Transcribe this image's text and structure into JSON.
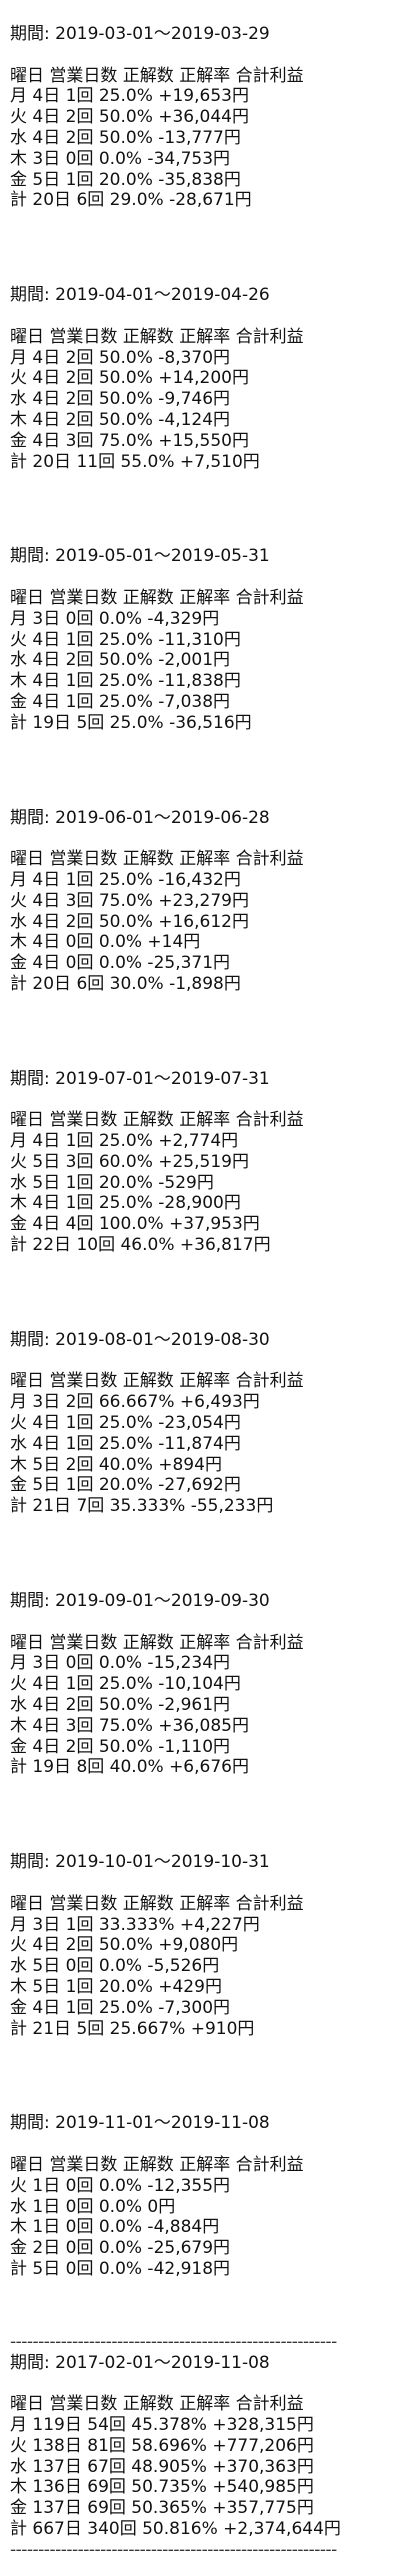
{
  "sections": [
    {
      "period": "期間: 2019-03-01～2019-03-29",
      "header": "曜日 営業日数 正解数 正解率 合計利益",
      "rows": [
        "月 4日 1回 25.0% +19,653円",
        "火 4日 2回 50.0% +36,044円",
        "水 4日 2回 50.0% -13,777円",
        "木 3日 0回 0.0% -34,753円",
        "金 5日 1回 20.0% -35,838円",
        "計 20日 6回 29.0% -28,671円"
      ]
    },
    {
      "period": "期間: 2019-04-01～2019-04-26",
      "header": "曜日 営業日数 正解数 正解率 合計利益",
      "rows": [
        "月 4日 2回 50.0% -8,370円",
        "火 4日 2回 50.0% +14,200円",
        "水 4日 2回 50.0% -9,746円",
        "木 4日 2回 50.0% -4,124円",
        "金 4日 3回 75.0% +15,550円",
        "計 20日 11回 55.0% +7,510円"
      ]
    },
    {
      "period": "期間: 2019-05-01～2019-05-31",
      "header": "曜日 営業日数 正解数 正解率 合計利益",
      "rows": [
        "月 3日 0回 0.0% -4,329円",
        "火 4日 1回 25.0% -11,310円",
        "水 4日 2回 50.0% -2,001円",
        "木 4日 1回 25.0% -11,838円",
        "金 4日 1回 25.0% -7,038円",
        "計 19日 5回 25.0% -36,516円"
      ]
    },
    {
      "period": "期間: 2019-06-01～2019-06-28",
      "header": "曜日 営業日数 正解数 正解率 合計利益",
      "rows": [
        "月 4日 1回 25.0% -16,432円",
        "火 4日 3回 75.0% +23,279円",
        "水 4日 2回 50.0% +16,612円",
        "木 4日 0回 0.0% +14円",
        "金 4日 0回 0.0% -25,371円",
        "計 20日 6回 30.0% -1,898円"
      ]
    },
    {
      "period": "期間: 2019-07-01～2019-07-31",
      "header": "曜日 営業日数 正解数 正解率 合計利益",
      "rows": [
        "月 4日 1回 25.0% +2,774円",
        "火 5日 3回 60.0% +25,519円",
        "水 5日 1回 20.0% -529円",
        "木 4日 1回 25.0% -28,900円",
        "金 4日 4回 100.0% +37,953円",
        "計 22日 10回 46.0% +36,817円"
      ]
    },
    {
      "period": "期間: 2019-08-01～2019-08-30",
      "header": "曜日 営業日数 正解数 正解率 合計利益",
      "rows": [
        "月 3日 2回 66.667% +6,493円",
        "火 4日 1回 25.0% -23,054円",
        "水 4日 1回 25.0% -11,874円",
        "木 5日 2回 40.0% +894円",
        "金 5日 1回 20.0% -27,692円",
        "計 21日 7回 35.333% -55,233円"
      ]
    },
    {
      "period": "期間: 2019-09-01～2019-09-30",
      "header": "曜日 営業日数 正解数 正解率 合計利益",
      "rows": [
        "月 3日 0回 0.0% -15,234円",
        "火 4日 1回 25.0% -10,104円",
        "水 4日 2回 50.0% -2,961円",
        "木 4日 3回 75.0% +36,085円",
        "金 4日 2回 50.0% -1,110円",
        "計 19日 8回 40.0% +6,676円"
      ]
    },
    {
      "period": "期間: 2019-10-01～2019-10-31",
      "header": "曜日 営業日数 正解数 正解率 合計利益",
      "rows": [
        "月 3日 1回 33.333% +4,227円",
        "火 4日 2回 50.0% +9,080円",
        "水 5日 0回 0.0% -5,526円",
        "木 5日 1回 20.0% +429円",
        "金 4日 1回 25.0% -7,300円",
        "計 21日 5回 25.667% +910円"
      ]
    },
    {
      "period": "期間: 2019-11-01～2019-11-08",
      "header": "曜日 営業日数 正解数 正解率 合計利益",
      "rows": [
        "火 1日 0回 0.0% -12,355円",
        "水 1日 0回 0.0% 0円",
        "木 1日 0回 0.0% -4,884円",
        "金 2日 0回 0.0% -25,679円",
        "計 5日 0回 0.0% -42,918円"
      ]
    }
  ],
  "summary": {
    "separator_top": "----------------------------------------------------------",
    "period": "期間: 2017-02-01～2019-11-08",
    "header": "曜日 営業日数 正解数 正解率 合計利益",
    "rows": [
      "月 119日 54回 45.378% +328,315円",
      "火 138日 81回 58.696% +777,206円",
      "水 137日 67回 48.905% +370,363円",
      "木 136日 69回 50.735% +540,985円",
      "金 137日 69回 50.365% +357,775円",
      "計 667日 340回 50.816% +2,374,644円"
    ],
    "separator_bottom": "----------------------------------------------------------"
  }
}
